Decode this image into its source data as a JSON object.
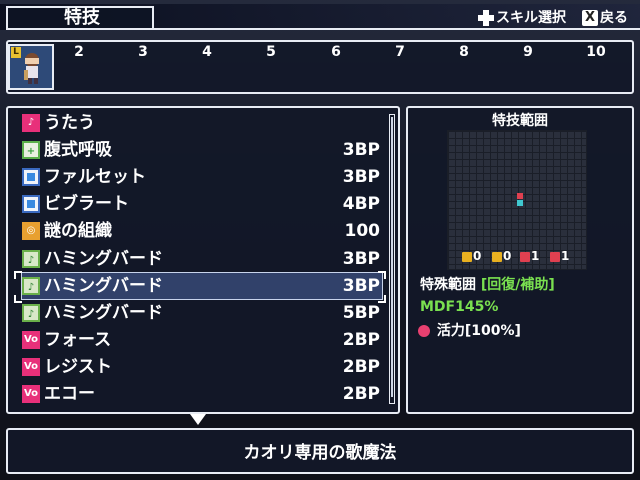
{
  "header": {
    "title": "特技",
    "hint_skill_select": "スキル選択",
    "hint_back": "戻る",
    "back_button_glyph": "X"
  },
  "party": {
    "leader_badge": "L",
    "slots": [
      "2",
      "3",
      "4",
      "5",
      "6",
      "7",
      "8",
      "9",
      "10"
    ]
  },
  "skills": [
    {
      "name": "うたう",
      "cost": "",
      "icon": "music-note-icon",
      "icon_glyph": "♪"
    },
    {
      "name": "腹式呼吸",
      "cost": "3BP",
      "icon": "plus-icon",
      "icon_glyph": "+"
    },
    {
      "name": "ファルセット",
      "cost": "3BP",
      "icon": "blue-square-icon",
      "icon_glyph": ""
    },
    {
      "name": "ビブラート",
      "cost": "4BP",
      "icon": "blue-square-icon",
      "icon_glyph": ""
    },
    {
      "name": "謎の組織",
      "cost": "100",
      "icon": "gold-pattern-icon",
      "icon_glyph": "◎"
    },
    {
      "name": "ハミングバード",
      "cost": "3BP",
      "icon": "music-note-icon",
      "icon_glyph": "♪"
    },
    {
      "name": "ハミングバード",
      "cost": "3BP",
      "icon": "music-plus-icon",
      "icon_glyph": "♪"
    },
    {
      "name": "ハミングバード",
      "cost": "5BP",
      "icon": "music-plus2-icon",
      "icon_glyph": "♪"
    },
    {
      "name": "フォース",
      "cost": "2BP",
      "icon": "vo-icon",
      "icon_glyph": "Vo"
    },
    {
      "name": "レジスト",
      "cost": "2BP",
      "icon": "vo-icon",
      "icon_glyph": "Vo"
    },
    {
      "name": "エコー",
      "cost": "2BP",
      "icon": "vo-icon",
      "icon_glyph": "Vo"
    }
  ],
  "selected_index": 6,
  "range_panel": {
    "title": "特技範囲",
    "stats": [
      "0",
      "0",
      "1",
      "1"
    ],
    "special_range_label": "特殊範囲",
    "special_range_open": "[",
    "special_range_value1": "回復",
    "special_range_sep": "/",
    "special_range_value2": "補助",
    "special_range_close": "]",
    "mdf": "MDF145%",
    "vitality": "活力[100%]"
  },
  "description": "カオリ専用の歌魔法",
  "colors": {
    "accent_pink": "#e8307a",
    "accent_green": "#7ae050",
    "grid_red": "#e04050",
    "grid_cyan": "#40c8d0",
    "panel_border": "#e8ecf4"
  }
}
